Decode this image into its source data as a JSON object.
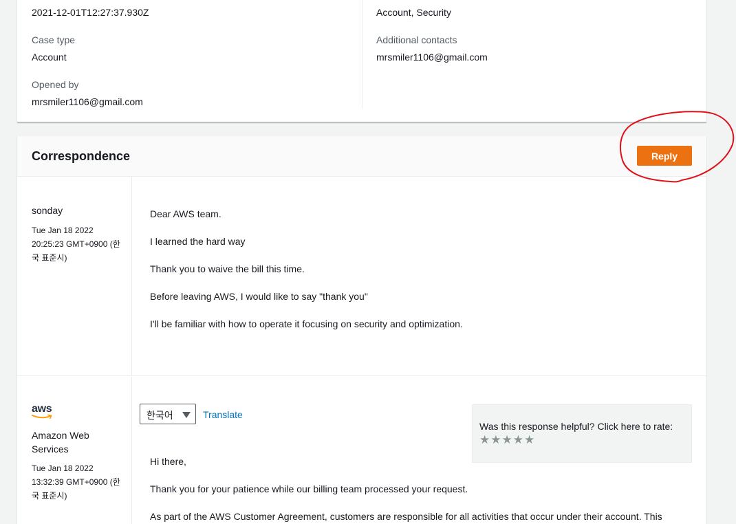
{
  "details": {
    "created_value": "2021-12-01T12:27:37.930Z",
    "case_type_label": "Case type",
    "case_type_value": "Account",
    "opened_by_label": "Opened by",
    "opened_by_value": "mrsmiler1106@gmail.com",
    "category_value": "Account, Security",
    "additional_contacts_label": "Additional contacts",
    "additional_contacts_value": "mrsmiler1106@gmail.com"
  },
  "correspondence": {
    "title": "Correspondence",
    "reply_label": "Reply",
    "annotation_color": "#e0101a",
    "accent_color": "#ec7211",
    "messages": [
      {
        "author": "sonday",
        "date_lines": [
          "Tue Jan 18 2022",
          "20:25:23 GMT+0900 (한",
          "국 표준시)"
        ],
        "body": [
          "Dear AWS team.",
          "I learned the hard way",
          "Thank you to waive the bill this time.",
          "Before leaving AWS, I would like to say \"thank you\"",
          "I'll be familiar with how to operate it focusing on security and optimization."
        ]
      },
      {
        "logo_icon": "aws-logo-icon",
        "logo_text": "aws",
        "author_lines": [
          "Amazon Web",
          "Services"
        ],
        "date_lines": [
          "Tue Jan 18 2022",
          "13:32:39 GMT+0900 (한",
          "국 표준시)"
        ],
        "language_select": "한국어",
        "translate_label": "Translate",
        "rating_prompt": "Was this response helpful? Click here to rate:",
        "rating_stars": 5,
        "rating_value": 0,
        "body": [
          "Hi there,",
          "Thank you for your patience while our billing team processed your request.",
          "As part of the AWS Customer Agreement, customers are responsible for all activities that occur under their account. This"
        ]
      }
    ]
  }
}
